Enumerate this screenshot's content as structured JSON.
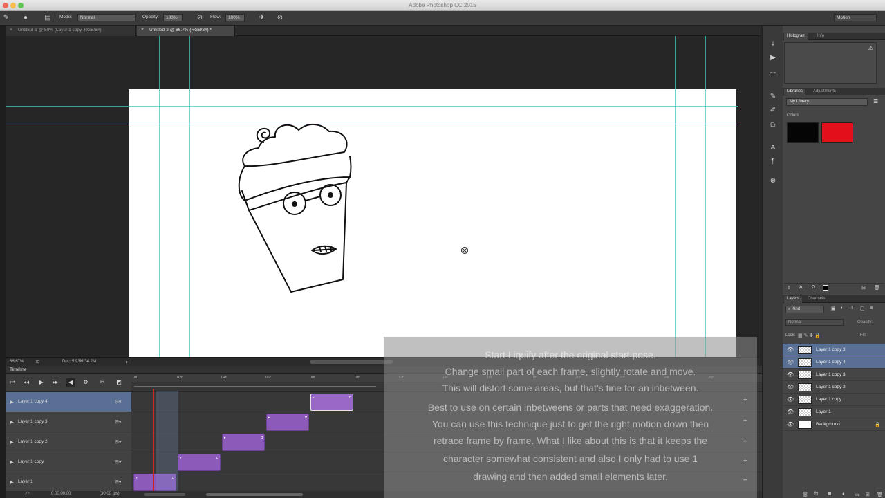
{
  "window": {
    "title": "Adobe Photoshop CC 2015",
    "profile": "Motion"
  },
  "options_bar": {
    "mode_label": "Mode:",
    "mode_value": "Normal",
    "opacity_label": "Opacity:",
    "opacity_value": "100%",
    "flow_label": "Flow:",
    "flow_value": "100%"
  },
  "doc_tabs": [
    {
      "label": "Untitled-1 @ 50% (Layer 1 copy, RGB/8#)",
      "close": "×"
    },
    {
      "label": "Untitled-2 @ 66.7% (RGB/8#) *",
      "close": "×"
    }
  ],
  "status": {
    "zoom": "66.67%",
    "doc": "Doc: 5.93M/34.2M"
  },
  "timeline": {
    "title": "Timeline",
    "ruler_ticks": [
      "00",
      "02f",
      "04f",
      "06f",
      "08f",
      "10f",
      "12f",
      "14f",
      "16f",
      "18f",
      "20f",
      "22f",
      "24f",
      "26f"
    ],
    "tracks": [
      {
        "name": "Layer 1 copy 4",
        "selected": true
      },
      {
        "name": "Layer 1 copy 3",
        "selected": false
      },
      {
        "name": "Layer 1 copy 2",
        "selected": false
      },
      {
        "name": "Layer 1 copy",
        "selected": false
      },
      {
        "name": "Layer 1",
        "selected": false
      }
    ],
    "timecode": "0:00:00:00",
    "fps": "(30.00 fps)"
  },
  "subtitles": [
    "Start Liquify after the original start pose.",
    "Change small part of each frame, slightly rotate and move.",
    "This will distort some areas, but that's fine for an inbetween.",
    "Best to use on certain inbetweens or parts that need exaggeration.",
    "You can use this technique just to get the right motion down then",
    "retrace frame by frame. What I like about this is that it keeps the",
    "character somewhat consistent and also I only had to use 1",
    "drawing and then added small elements later."
  ],
  "panels": {
    "histogram_tabs": [
      "Histogram",
      "Info"
    ],
    "libraries_tabs": [
      "Libraries",
      "Adjustments"
    ],
    "library_name": "My Library",
    "colors_label": "Colors",
    "swatches": [
      "#050505",
      "#e3101c"
    ],
    "layers_tabs": [
      "Layers",
      "Channels"
    ],
    "kind_label": "Kind",
    "blend_mode": "Normal",
    "opacity_label": "Opacity:",
    "lock_label": "Lock:",
    "fill_label": "Fill:",
    "layers": [
      {
        "name": "Layer 1 copy 3",
        "selected": true,
        "thumb": "transparent"
      },
      {
        "name": "Layer 1 copy 4",
        "selected": true,
        "thumb": "transparent"
      },
      {
        "name": "Layer 1 copy 3",
        "selected": false,
        "thumb": "transparent"
      },
      {
        "name": "Layer 1 copy 2",
        "selected": false,
        "thumb": "transparent"
      },
      {
        "name": "Layer 1 copy",
        "selected": false,
        "thumb": "transparent"
      },
      {
        "name": "Layer 1",
        "selected": false,
        "thumb": "transparent"
      },
      {
        "name": "Background",
        "selected": false,
        "thumb": "white",
        "locked": true
      }
    ]
  }
}
